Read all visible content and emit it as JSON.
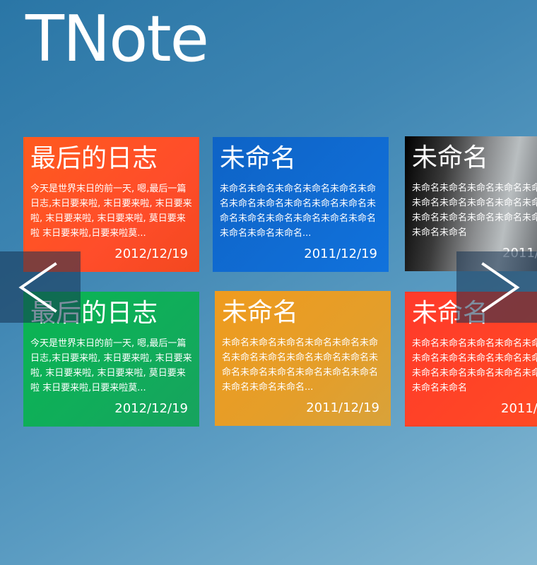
{
  "app": {
    "title": "TNote"
  },
  "notes": [
    {
      "title": "最后的日志",
      "body": "今天是世界末日的前一天, 嗯,最后一篇日志,末日要来啦, 末日要来啦, 末日要来啦, 末日要来啦, 末日要来啦, 莫日要来啦 末日要来啦,日要来啦莫...",
      "date": "2012/12/19",
      "color": "#ff5a1e"
    },
    {
      "title": "未命名",
      "body": "未命名未命名未命名未命名未命名未命名未命名未命名未命名未命名未命名未命名未命名未命名未命名未命名未命名未命名未命名未命名...",
      "date": "2011/12/19",
      "color": "#1172dc"
    },
    {
      "title": "未命名",
      "body": "未命名未命名未命名未命名未命名未命名未命名未命名未命名未命名未命名未命名未命名未命名未命名未命名未命名未命名未命名未命名",
      "date": "2011/",
      "color": "#3a3a3a"
    },
    {
      "title": "最后的日志",
      "body": "今天是世界末日的前一天, 嗯,最后一篇日志,末日要来啦, 末日要来啦, 末日要来啦, 末日要来啦, 末日要来啦, 莫日要来啦 末日要来啦,日要来啦莫...",
      "date": "2012/12/19",
      "color": "#10ad5a"
    },
    {
      "title": "未命名",
      "body": "未命名未命名未命名未命名未命名未命名未命名未命名未命名未命名未命名未命名未命名未命名未命名未命名未命名未命名未命名未命名...",
      "date": "2011/12/19",
      "color": "#e49e2a"
    },
    {
      "title": "未命名",
      "body": "未命名未命名未命名未命名未命名未命名未命名未命名未命名未命名未命名未命名未命名未命名未命名未命名未命名未命名未命名未命名",
      "date": "2011/",
      "color": "#ff4a24"
    }
  ],
  "navigation": {
    "prev_icon": "chevron-left-icon",
    "next_icon": "chevron-right-icon"
  }
}
